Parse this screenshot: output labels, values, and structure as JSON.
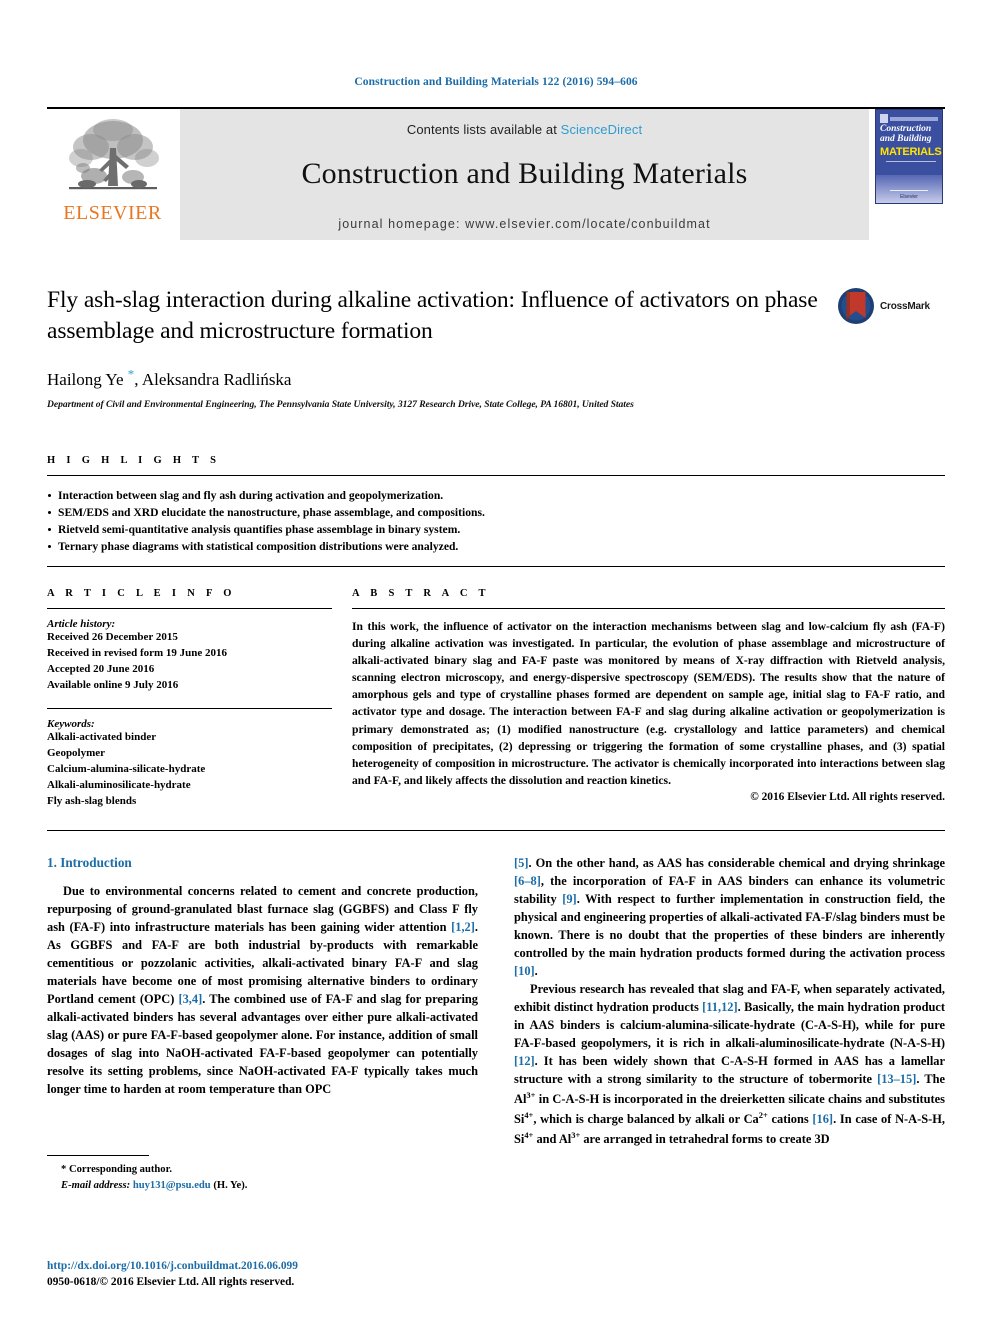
{
  "running_head": "Construction and Building Materials 122 (2016) 594–606",
  "masthead": {
    "publisher_logo_label": "ELSEVIER",
    "contents_prefix": "Contents lists available at",
    "contents_link": "ScienceDirect",
    "journal_title": "Construction and Building Materials",
    "homepage": "journal homepage: www.elsevier.com/locate/conbuildmat",
    "cover": {
      "line1": "Construction",
      "line2": "and Building",
      "line3": "MATERIALS",
      "footer_text": "Elsevier"
    }
  },
  "article": {
    "title": "Fly ash-slag interaction during alkaline activation: Influence of activators on phase assemblage and microstructure formation",
    "crossmark_label": "CrossMark",
    "authors": "Hailong Ye *, Aleksandra Radlińska",
    "affiliation": "Department of Civil and Environmental Engineering, The Pennsylvania State University, 3127 Research Drive, State College, PA 16801, United States"
  },
  "highlights": {
    "heading": "H I G H L I G H T S",
    "items": [
      "Interaction between slag and fly ash during activation and geopolymerization.",
      "SEM/EDS and XRD elucidate the nanostructure, phase assemblage, and compositions.",
      "Rietveld semi-quantitative analysis quantifies phase assemblage in binary system.",
      "Ternary phase diagrams with statistical composition distributions were analyzed."
    ]
  },
  "article_info": {
    "heading": "A R T I C L E I N F O",
    "history_label": "Article history:",
    "history": [
      "Received 26 December 2015",
      "Received in revised form 19 June 2016",
      "Accepted 20 June 2016",
      "Available online 9 July 2016"
    ],
    "keywords_label": "Keywords:",
    "keywords": [
      "Alkali-activated binder",
      "Geopolymer",
      "Calcium-alumina-silicate-hydrate",
      "Alkali-aluminosilicate-hydrate",
      "Fly ash-slag blends"
    ]
  },
  "abstract": {
    "heading": "A B S T R A C T",
    "text": "In this work, the influence of activator on the interaction mechanisms between slag and low-calcium fly ash (FA-F) during alkaline activation was investigated. In particular, the evolution of phase assemblage and microstructure of alkali-activated binary slag and FA-F paste was monitored by means of X-ray diffraction with Rietveld analysis, scanning electron microscopy, and energy-dispersive spectroscopy (SEM/EDS). The results show that the nature of amorphous gels and type of crystalline phases formed are dependent on sample age, initial slag to FA-F ratio, and activator type and dosage. The interaction between FA-F and slag during alkaline activation or geopolymerization is primary demonstrated as; (1) modified nanostructure (e.g. crystallology and lattice parameters) and chemical composition of precipitates, (2) depressing or triggering the formation of some crystalline phases, and (3) spatial heterogeneity of composition in microstructure. The activator is chemically incorporated into interactions between slag and FA-F, and likely affects the dissolution and reaction kinetics.",
    "copyright": "© 2016 Elsevier Ltd. All rights reserved."
  },
  "body": {
    "section_title": "1. Introduction",
    "left_paragraphs": [
      "Due to environmental concerns related to cement and concrete production, repurposing of ground-granulated blast furnace slag (GGBFS) and Class F fly ash (FA-F) into infrastructure materials has been gaining wider attention [1,2]. As GGBFS and FA-F are both industrial by-products with remarkable cementitious or pozzolanic activities, alkali-activated binary FA-F and slag materials have become one of most promising alternative binders to ordinary Portland cement (OPC) [3,4]. The combined use of FA-F and slag for preparing alkali-activated binders has several advantages over either pure alkali-activated slag (AAS) or pure FA-F-based geopolymer alone. For instance, addition of small dosages of slag into NaOH-activated FA-F-based geopolymer can potentially resolve its setting problems, since NaOH-activated FA-F typically takes much longer time to harden at room temperature than OPC"
    ],
    "right_paragraphs": [
      "[5]. On the other hand, as AAS has considerable chemical and drying shrinkage [6–8], the incorporation of FA-F in AAS binders can enhance its volumetric stability [9]. With respect to further implementation in construction field, the physical and engineering properties of alkali-activated FA-F/slag binders must be known. There is no doubt that the properties of these binders are inherently controlled by the main hydration products formed during the activation process [10].",
      "Previous research has revealed that slag and FA-F, when separately activated, exhibit distinct hydration products [11,12]. Basically, the main hydration product in AAS binders is calcium-alumina-silicate-hydrate (C-A-S-H), while for pure FA-F-based geopolymers, it is rich in alkali-aluminosilicate-hydrate (N-A-S-H) [12]. It has been widely shown that C-A-S-H formed in AAS has a lamellar structure with a strong similarity to the structure of tobermorite [13–15]. The Al3+ in C-A-S-H is incorporated in the dreierketten silicate chains and substitutes Si4+, which is charge balanced by alkali or Ca2+ cations [16]. In case of N-A-S-H, Si4+ and Al3+ are arranged in tetrahedral forms to create 3D"
    ]
  },
  "footnote": {
    "corresponding_author": "* Corresponding author.",
    "email_label": "E-mail address:",
    "email": "huy131@psu.edu",
    "email_suffix": "(H. Ye)."
  },
  "page_footer": {
    "doi": "http://dx.doi.org/10.1016/j.conbuildmat.2016.06.099",
    "issn": "0950-0618/© 2016 Elsevier Ltd. All rights reserved."
  },
  "colors": {
    "link_blue": "#1b6ca8",
    "sciencedirect_blue": "#2e9cd1",
    "elsevier_orange": "#e87722",
    "masthead_grey": "#e4e4e4",
    "cover_blue": "#3b4fa0",
    "cover_yellow": "#ffe500",
    "crossmark_red": "#c0392b"
  }
}
